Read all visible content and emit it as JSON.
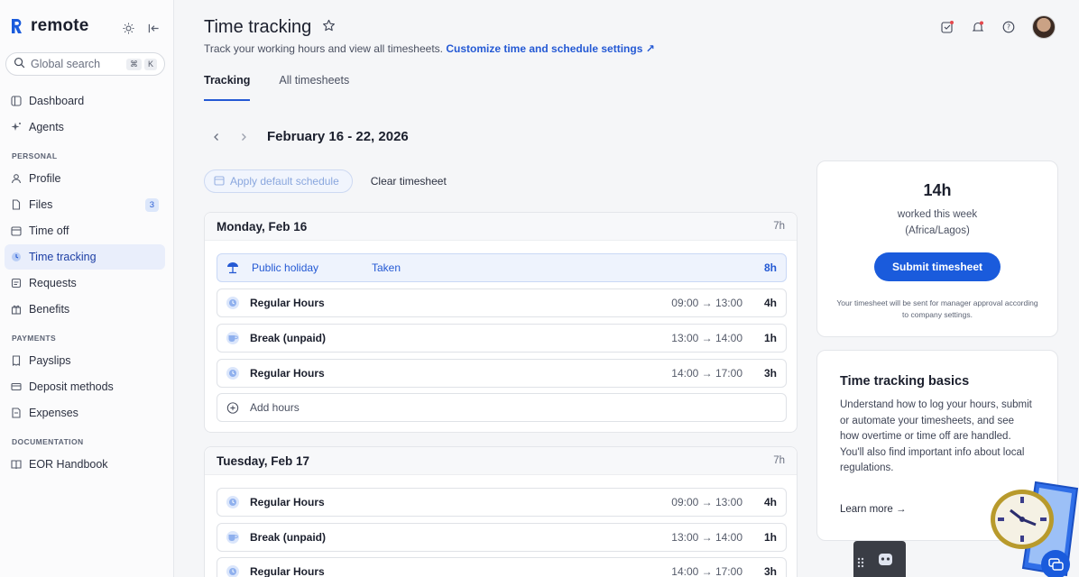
{
  "brand": {
    "name": "remote"
  },
  "search": {
    "placeholder": "Global search",
    "kbd1": "⌘",
    "kbd2": "K"
  },
  "nav": {
    "top": [
      {
        "label": "Dashboard",
        "icon": "layout-icon"
      },
      {
        "label": "Agents",
        "icon": "sparkle-icon"
      }
    ],
    "personal_heading": "PERSONAL",
    "personal": [
      {
        "label": "Profile",
        "icon": "user-icon"
      },
      {
        "label": "Files",
        "icon": "file-icon",
        "badge": "3"
      },
      {
        "label": "Time off",
        "icon": "calendar-icon"
      },
      {
        "label": "Time tracking",
        "icon": "clock-icon",
        "active": true
      },
      {
        "label": "Requests",
        "icon": "request-icon"
      },
      {
        "label": "Benefits",
        "icon": "gift-icon"
      }
    ],
    "payments_heading": "PAYMENTS",
    "payments": [
      {
        "label": "Payslips",
        "icon": "payslip-icon"
      },
      {
        "label": "Deposit methods",
        "icon": "bank-icon"
      },
      {
        "label": "Expenses",
        "icon": "receipt-icon"
      }
    ],
    "documentation_heading": "DOCUMENTATION",
    "documentation": [
      {
        "label": "EOR Handbook",
        "icon": "book-icon"
      }
    ]
  },
  "page": {
    "title": "Time tracking",
    "subtitle": "Track your working hours and view all timesheets.",
    "subtitle_link": "Customize time and schedule settings"
  },
  "tabs": {
    "tracking": "Tracking",
    "all": "All timesheets"
  },
  "week": {
    "label": "February 16 - 22, 2026"
  },
  "actions": {
    "apply": "Apply default schedule",
    "clear": "Clear timesheet"
  },
  "days": [
    {
      "title": "Monday, Feb 16",
      "total": "7h",
      "holiday": {
        "name": "Public holiday",
        "status": "Taken",
        "hours": "8h"
      },
      "entries": [
        {
          "name": "Regular Hours",
          "time": "09:00 → 13:00",
          "hours": "4h"
        },
        {
          "name": "Break (unpaid)",
          "time": "13:00 → 14:00",
          "hours": "1h"
        },
        {
          "name": "Regular Hours",
          "time": "14:00 → 17:00",
          "hours": "3h"
        }
      ],
      "add_label": "Add hours"
    },
    {
      "title": "Tuesday, Feb 17",
      "total": "7h",
      "entries": [
        {
          "name": "Regular Hours",
          "time": "09:00 → 13:00",
          "hours": "4h"
        },
        {
          "name": "Break (unpaid)",
          "time": "13:00 → 14:00",
          "hours": "1h"
        },
        {
          "name": "Regular Hours",
          "time": "14:00 → 17:00",
          "hours": "3h"
        }
      ]
    }
  ],
  "summary": {
    "hours": "14h",
    "worked": "worked this week",
    "timezone": "(Africa/Lagos)",
    "submit": "Submit timesheet",
    "note": "Your timesheet will be sent for manager approval according to company settings."
  },
  "basics": {
    "title": "Time tracking basics",
    "body": "Understand how to log your hours, submit or automate your timesheets, and see how overtime or time off are handled. You'll also find important info about local regulations.",
    "learn": "Learn more →"
  },
  "colors": {
    "accent": "#1a5bdc",
    "active_bg": "#e9eefb"
  }
}
